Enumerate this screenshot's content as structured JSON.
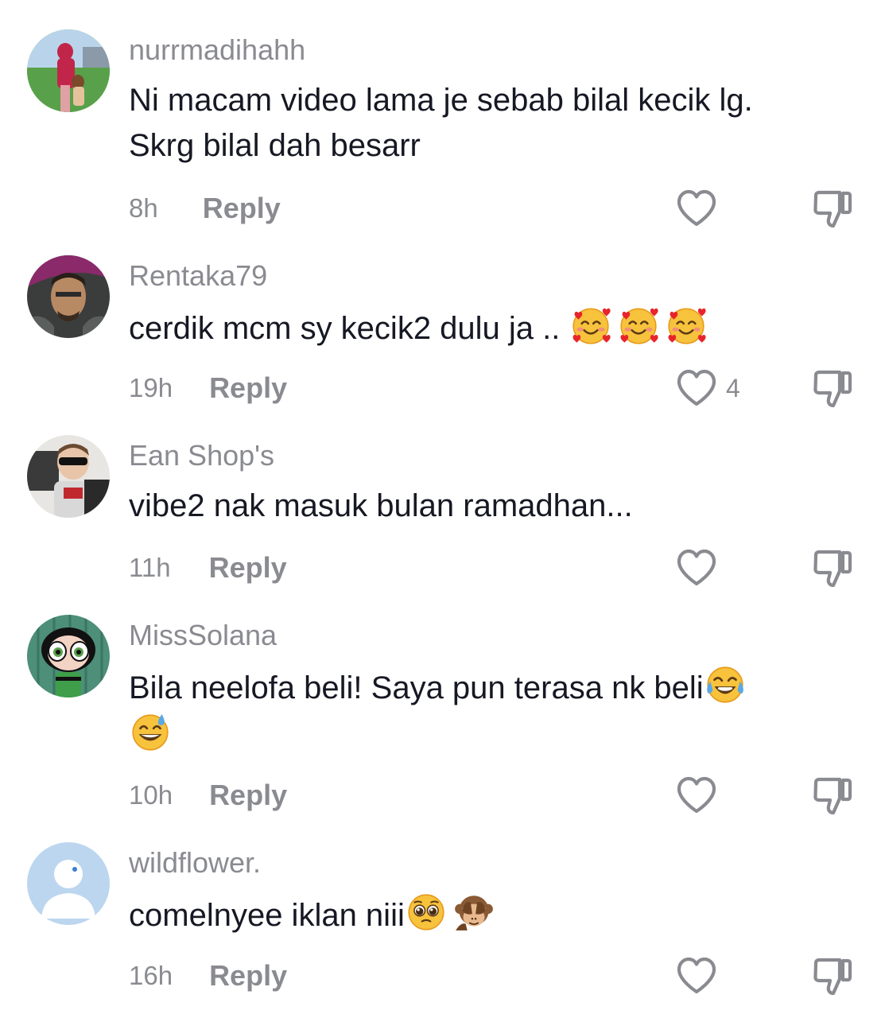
{
  "comments": [
    {
      "username": "nurrmadihahh",
      "text_line1": "Ni macam video lama je sebab bilal kecik lg.",
      "text_line2": "Skrg bilal dah besarr",
      "time": "8h",
      "reply_label": "Reply",
      "like_count": "",
      "like_icon": "heart-outline",
      "dislike_icon": "thumbs-down-outline"
    },
    {
      "username": "Rentaka79",
      "text": "cerdik mcm sy kecik2 dulu ja .. ",
      "emojis": [
        "smiling-face-with-hearts",
        "smiling-face-with-hearts",
        "smiling-face-with-hearts"
      ],
      "time": "19h",
      "reply_label": "Reply",
      "like_count": "4",
      "like_icon": "heart-outline",
      "dislike_icon": "thumbs-down-outline"
    },
    {
      "username": "Ean Shop's",
      "text": "vibe2 nak masuk bulan ramadhan...",
      "time": "11h",
      "reply_label": "Reply",
      "like_count": "",
      "like_icon": "heart-outline",
      "dislike_icon": "thumbs-down-outline"
    },
    {
      "username": "MissSolana",
      "text": "Bila neelofa beli! Saya pun terasa nk beli",
      "emojis": [
        "face-with-tears-of-joy",
        "grinning-face-with-sweat"
      ],
      "time": "10h",
      "reply_label": "Reply",
      "like_count": "",
      "like_icon": "heart-outline",
      "dislike_icon": "thumbs-down-outline"
    },
    {
      "username": "wildflower.",
      "text": "comelnyee iklan niii",
      "emojis": [
        "pleading-face",
        "see-no-evil-monkey"
      ],
      "time": "16h",
      "reply_label": "Reply",
      "like_count": "",
      "like_icon": "heart-outline",
      "dislike_icon": "thumbs-down-outline"
    }
  ],
  "colors": {
    "text": "#161823",
    "secondary": "#8a8b91",
    "icon": "#8a8b91",
    "background": "#ffffff"
  }
}
